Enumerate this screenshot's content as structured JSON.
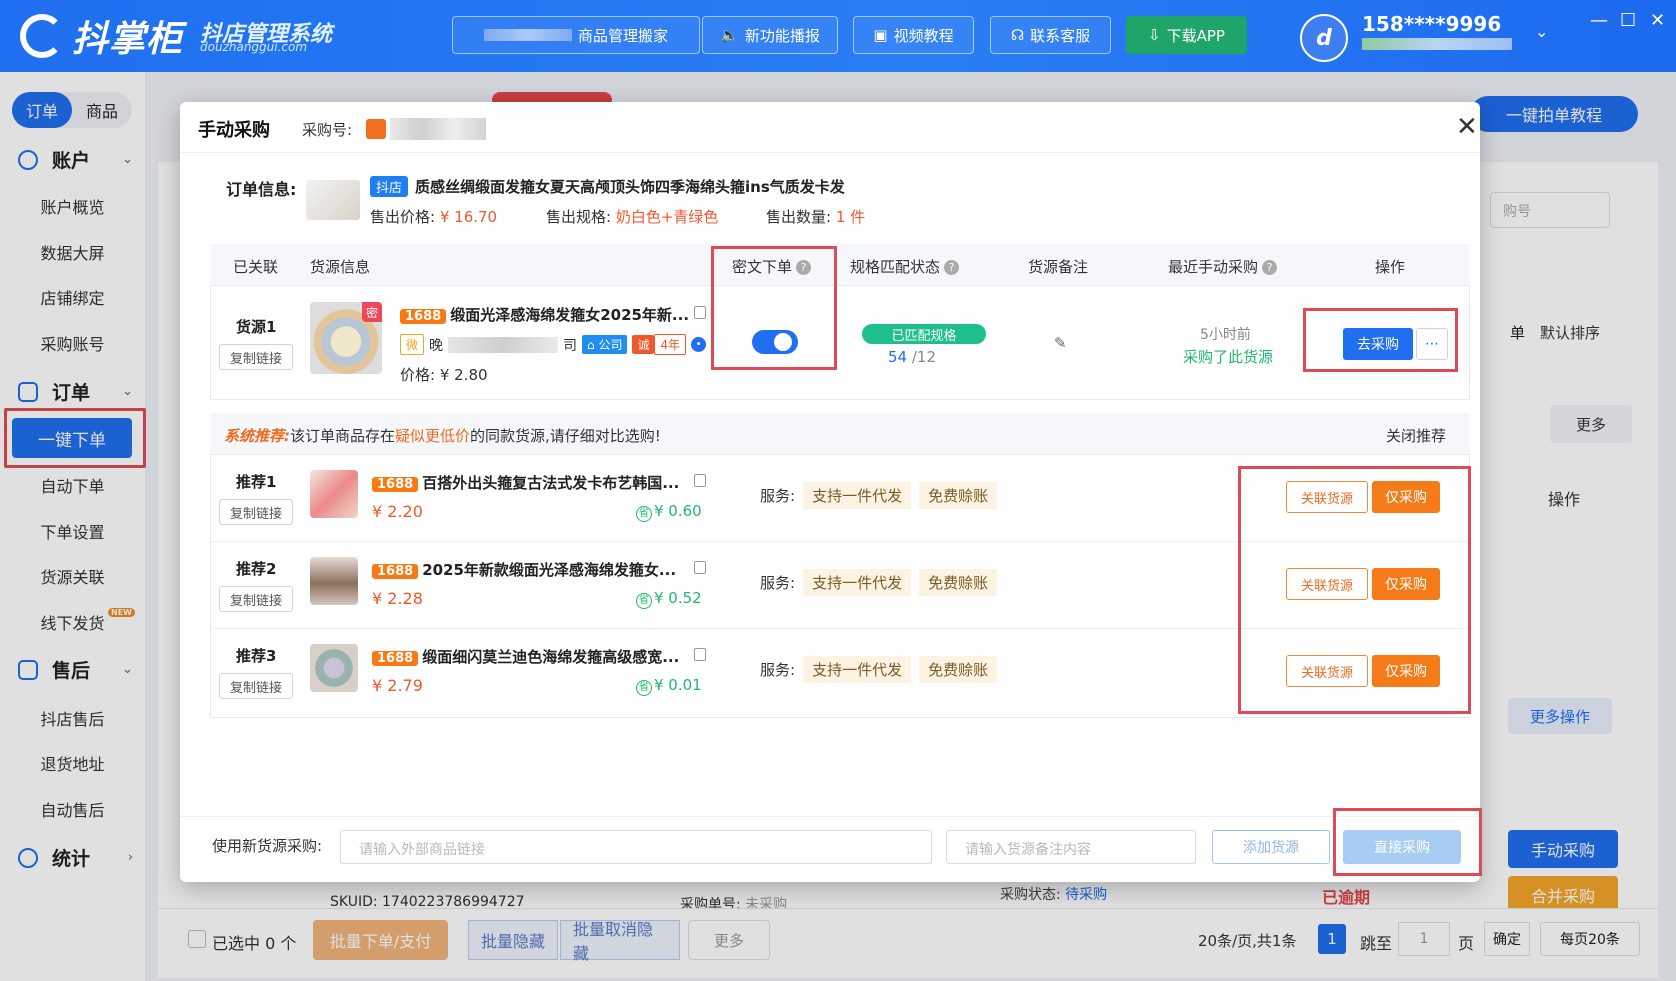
{
  "app": {
    "logo_text": "抖掌柜",
    "logo_sub": "抖店管理系统",
    "logo_url": "douzhanggui.com"
  },
  "header": {
    "buttons": [
      "商品管理搬家",
      "新功能播报",
      "视频教程",
      "联系客服",
      "下载APP"
    ],
    "user_phone": "158****9996",
    "avatar_icon": "store-logo-icon"
  },
  "sidebar": {
    "tabs": [
      "订单",
      "商品"
    ],
    "groups": [
      {
        "title": "账户",
        "items": [
          "账户概览",
          "数据大屏",
          "店铺绑定",
          "采购账号"
        ]
      },
      {
        "title": "订单",
        "items": [
          "一键下单",
          "自动下单",
          "下单设置",
          "货源关联",
          "线下发货"
        ]
      },
      {
        "title": "售后",
        "items": [
          "抖店售后",
          "退货地址",
          "自动售后"
        ]
      },
      {
        "title": "统计",
        "items": []
      }
    ],
    "new_badge": "NEW",
    "active_item": "一键下单"
  },
  "background": {
    "tutorial": "一键拍单教程",
    "select_placeholder": "购号",
    "sort": "默认排序",
    "more": "更多",
    "ops": "操作",
    "more_ops": "更多操作",
    "manual": "手动采购",
    "merge": "合并采购",
    "status_label": "采购状态:",
    "status_value": "待采购",
    "overdue": "已逾期",
    "skuid": "SKUID: 1740223786994727",
    "purchase_no_label": "采购单号:",
    "purchase_no_value": "未采购",
    "single": "单"
  },
  "bottom": {
    "selected": "已选中 0 个",
    "batch_order": "批量下单/支付",
    "batch_hide": "批量隐藏",
    "batch_unhide": "批量取消隐藏",
    "more": "更多",
    "page_info": "20条/页,共1条",
    "page": "1",
    "jump_to": "跳至",
    "jump_value": "1",
    "page_unit": "页",
    "confirm": "确定",
    "per_page": "每页20条"
  },
  "modal": {
    "title": "手动采购",
    "purchase_no_label": "采购号:",
    "order_info": {
      "label": "订单信息:",
      "platform_tag": "抖店",
      "title": "质感丝绸缎面发箍女夏天高颅顶头饰四季海绵头箍ins气质发卡发",
      "sale_price_label": "售出价格:",
      "sale_price": "¥ 16.70",
      "sale_spec_label": "售出规格:",
      "sale_spec": "奶白色+青绿色",
      "sale_qty_label": "售出数量:",
      "sale_qty": "1 件"
    },
    "table": {
      "headers": [
        "已关联",
        "货源信息",
        "密文下单",
        "规格匹配状态",
        "货源备注",
        "最近手动采购",
        "操作"
      ],
      "source": {
        "label": "货源1",
        "copy": "复制链接",
        "tag": "1688",
        "title": "缎面光泽感海绵发箍女2025年新...",
        "secret_badge": "密",
        "shop_prefix": "晚",
        "shop_suffix": "司",
        "company": "公司",
        "trust": "诚",
        "years": "4年",
        "price": "价格: ¥ 2.80",
        "secret_order_on": true,
        "match_status": "已匹配规格",
        "match_num": "54",
        "match_total": "/12",
        "recent_time": "5小时前",
        "recent_text": "采购了此货源",
        "go": "去采购"
      }
    },
    "recommend": {
      "prefix": "系统推荐:",
      "text_before": "该订单商品存在",
      "text_em": "疑似更低价",
      "text_after": "的同款货源,请仔细对比选购!",
      "close": "关闭推荐",
      "service_label": "服务:",
      "services": [
        "支持一件代发",
        "免费赊账"
      ],
      "link_btn": "关联货源",
      "only_btn": "仅采购",
      "items": [
        {
          "label": "推荐1",
          "title": "百搭外出头箍复古法式发卡布艺韩国...",
          "price": "¥ 2.20",
          "save": "¥ 0.60"
        },
        {
          "label": "推荐2",
          "title": "2025年新款缎面光泽感海绵发箍女...",
          "price": "¥ 2.28",
          "save": "¥ 0.52"
        },
        {
          "label": "推荐3",
          "title": "缎面细闪莫兰迪色海绵发箍高级感宽...",
          "price": "¥ 2.79",
          "save": "¥ 0.01"
        }
      ]
    },
    "footer": {
      "label": "使用新货源采购:",
      "link_placeholder": "请输入外部商品链接",
      "note_placeholder": "请输入货源备注内容",
      "add": "添加货源",
      "direct": "直接采购"
    }
  },
  "colors": {
    "primary": "#1f6ff0",
    "orange": "#f57b18",
    "green": "#1fb96b",
    "red_highlight": "#e04a55",
    "price": "#f0582c"
  }
}
